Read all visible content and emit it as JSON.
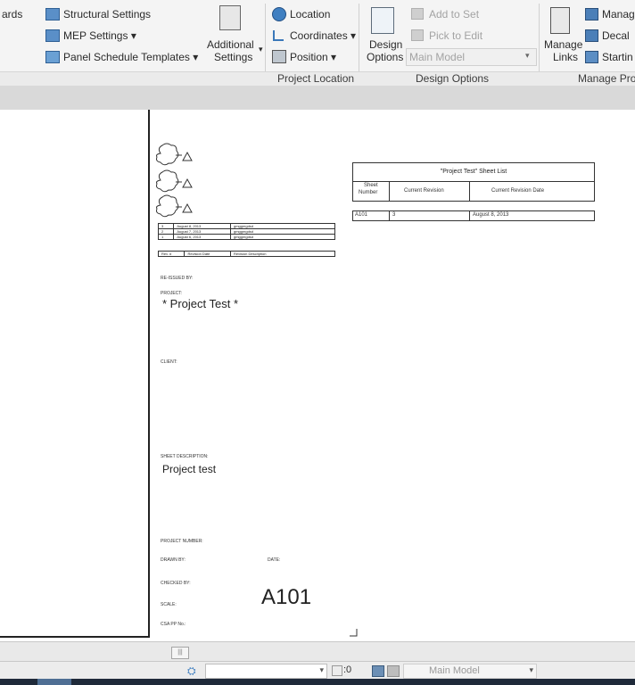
{
  "ribbon": {
    "truncated_left_label": "ards",
    "structural_settings": "Structural Settings",
    "mep_settings": "MEP Settings ▾",
    "panel_schedule_templates": "Panel Schedule Templates ▾",
    "additional_settings_line1": "Additional",
    "additional_settings_line2": "Settings",
    "location": "Location",
    "coordinates": "Coordinates ▾",
    "position": "Position ▾",
    "project_location_panel": "Project Location",
    "design_options_line1": "Design",
    "design_options_line2": "Options",
    "add_to_set": "Add to Set",
    "pick_to_edit": "Pick to Edit",
    "main_model_select": "Main Model",
    "design_options_panel": "Design Options",
    "manage_links_line1": "Manage",
    "manage_links_line2": "Links",
    "manage_truncated": "Manag",
    "decal": "Decal",
    "starting": "Startin",
    "manage_project_panel": "Manage Proj"
  },
  "sheet": {
    "schedule_title": "\"Project Test\"  Sheet List",
    "col_sheet_number_1": "Sheet",
    "col_sheet_number_2": "Number",
    "col_current_revision": "Current Revision",
    "col_current_revision_date": "Current Revision Date",
    "row_sheet_number": "A101",
    "row_revision": "3",
    "row_revision_date": "August 8, 2013",
    "rev_rows": [
      {
        "num": "3",
        "date": "August 8, 2013",
        "desc": "gmggmgdsd"
      },
      {
        "num": "2",
        "date": "August 7, 2013",
        "desc": "gmggmgdsd"
      },
      {
        "num": "1",
        "date": "August 6, 2013",
        "desc": "gmggmgdsd"
      }
    ],
    "rev_header_num": "Rev. #",
    "rev_header_date": "Revision Date",
    "rev_header_desc": "Revision Description",
    "lbl_tb1": "RE-ISSUED BY:",
    "lbl_project": "PROJECT:",
    "project_name": "* Project Test *",
    "lbl_client": "CLIENT:",
    "lbl_sheet_desc": "SHEET DESCRIPTION:",
    "sheet_desc": "Project test",
    "lbl_project_number": "PROJECT NUMBER:",
    "lbl_drawn_by": "DRAWN BY:",
    "lbl_date": "DATE:",
    "lbl_checked_by": "CHECKED BY:",
    "lbl_scale": "SCALE:",
    "lbl_csa": "CSA PP No.:",
    "sheet_number_big": "A101"
  },
  "status": {
    "scroll_marker": "|||",
    "zero": ":0",
    "main_model": "Main Model"
  }
}
